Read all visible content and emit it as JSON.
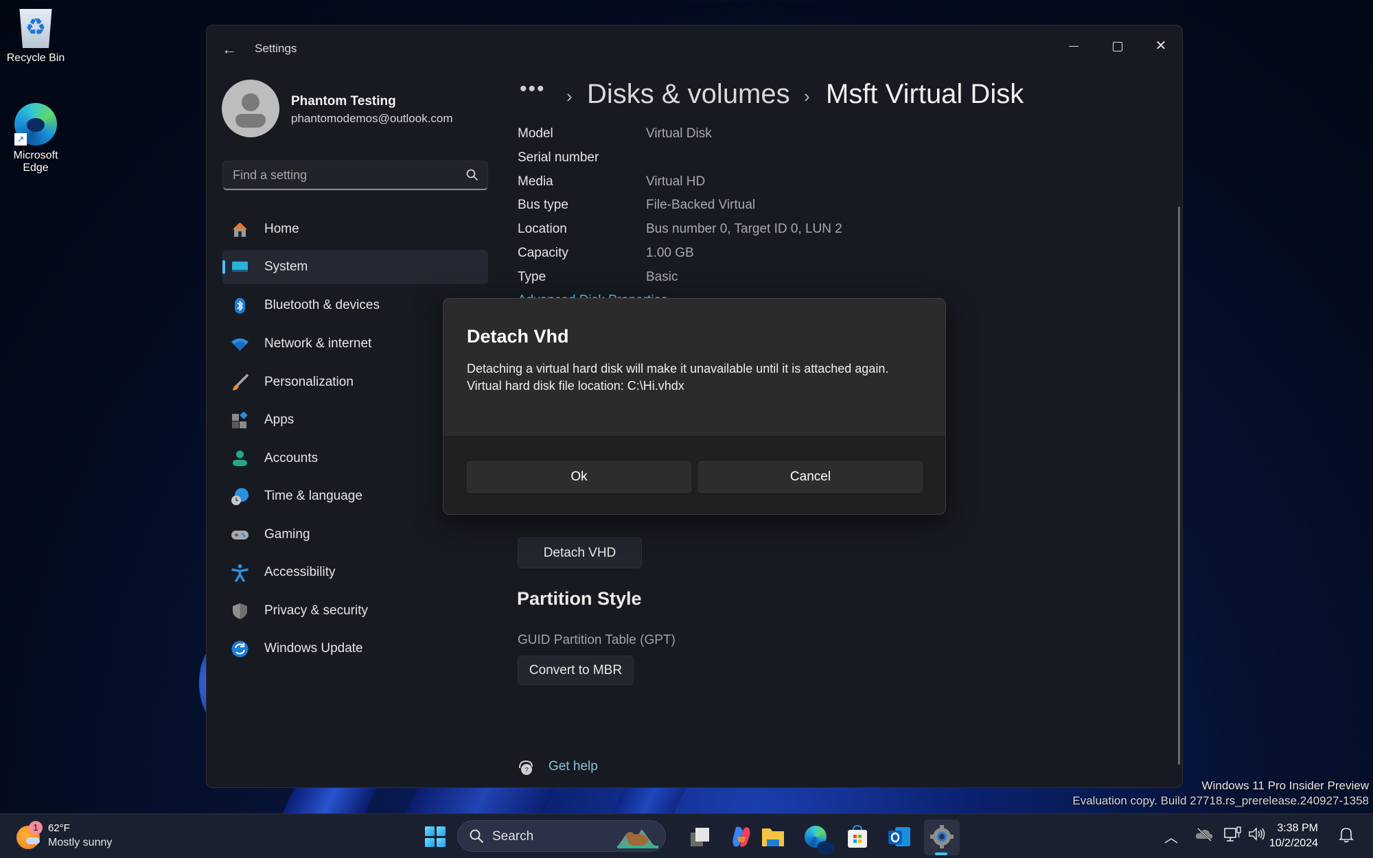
{
  "desktop": {
    "icons": [
      {
        "label": "Recycle Bin",
        "icon": "recycle-bin-icon"
      },
      {
        "label": "Microsoft Edge",
        "label_line1": "Microsoft",
        "label_line2": "Edge",
        "icon": "edge-icon"
      }
    ],
    "watermark": {
      "line1": "Windows 11 Pro Insider Preview",
      "line2": "Evaluation copy. Build 27718.rs_prerelease.240927-1358"
    }
  },
  "window": {
    "title": "Settings",
    "back_icon": "back-arrow-icon",
    "controls": {
      "minimize": "minimize-icon",
      "maximize": "maximize-icon",
      "close": "close-icon"
    }
  },
  "profile": {
    "name": "Phantom Testing",
    "email": "phantomodemos@outlook.com"
  },
  "search": {
    "placeholder": "Find a setting",
    "value": ""
  },
  "nav": {
    "selected": "System",
    "accent": "#4cc2ff",
    "items": [
      {
        "label": "Home",
        "icon": "home-icon"
      },
      {
        "label": "System",
        "icon": "system-icon"
      },
      {
        "label": "Bluetooth & devices",
        "icon": "bluetooth-icon"
      },
      {
        "label": "Network & internet",
        "icon": "wifi-icon"
      },
      {
        "label": "Personalization",
        "icon": "paintbrush-icon"
      },
      {
        "label": "Apps",
        "icon": "apps-icon"
      },
      {
        "label": "Accounts",
        "icon": "accounts-icon"
      },
      {
        "label": "Time & language",
        "icon": "time-language-icon"
      },
      {
        "label": "Gaming",
        "icon": "gamepad-icon"
      },
      {
        "label": "Accessibility",
        "icon": "accessibility-icon"
      },
      {
        "label": "Privacy & security",
        "icon": "shield-icon"
      },
      {
        "label": "Windows Update",
        "icon": "update-icon"
      }
    ]
  },
  "content": {
    "breadcrumb": {
      "overflow": "•••",
      "separator": "›",
      "parent": "Disks & volumes",
      "current": "Msft Virtual Disk"
    },
    "properties": [
      {
        "label": "Model",
        "value": "Virtual Disk"
      },
      {
        "label": "Serial number",
        "value": ""
      },
      {
        "label": "Media",
        "value": "Virtual HD"
      },
      {
        "label": "Bus type",
        "value": "File-Backed Virtual"
      },
      {
        "label": "Location",
        "value": "Bus number 0, Target ID 0, LUN 2"
      },
      {
        "label": "Capacity",
        "value": "1.00 GB"
      },
      {
        "label": "Type",
        "value": "Basic"
      }
    ],
    "advanced_link": "Advanced Disk Properties",
    "detach_button": "Detach VHD",
    "partition": {
      "title": "Partition Style",
      "value": "GUID Partition Table (GPT)",
      "convert_button": "Convert to MBR"
    },
    "help_link": "Get help"
  },
  "dialog": {
    "title": "Detach Vhd",
    "body_line1": "Detaching a virtual hard disk will make it unavailable until it is attached again.",
    "body_line2": "Virtual hard disk file location: C:\\Hi.vhdx",
    "ok_label": "Ok",
    "cancel_label": "Cancel"
  },
  "taskbar": {
    "weather": {
      "temp": "62°F",
      "desc": "Mostly sunny",
      "badge": "1"
    },
    "search_label": "Search",
    "apps": [
      "task-view-icon",
      "copilot-icon",
      "file-explorer-icon",
      "edge-icon",
      "store-icon",
      "outlook-icon",
      "settings-icon"
    ],
    "active_app": "Settings",
    "clock": {
      "time": "3:38 PM",
      "date": "10/2/2024"
    }
  }
}
